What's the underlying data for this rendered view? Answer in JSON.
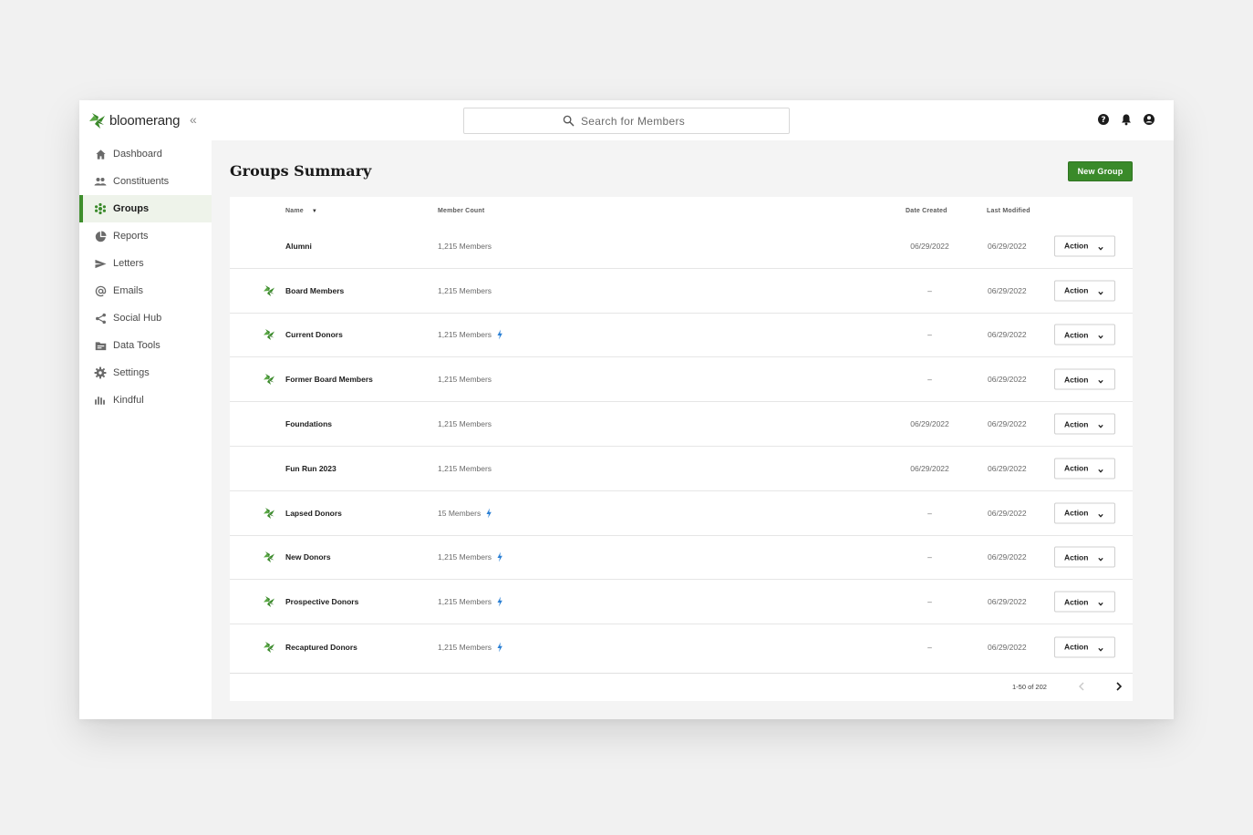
{
  "app": {
    "logo_text": "bloomerang",
    "brand_color": "#3a8a2a",
    "bolt_color": "#2a7fd4"
  },
  "search": {
    "placeholder": "Search for Members"
  },
  "top_icons": [
    "help-icon",
    "bell-icon",
    "account-icon"
  ],
  "sidebar": {
    "items": [
      {
        "label": "Dashboard",
        "icon": "home-icon",
        "active": false
      },
      {
        "label": "Constituents",
        "icon": "people-icon",
        "active": false
      },
      {
        "label": "Groups",
        "icon": "groups-icon",
        "active": true
      },
      {
        "label": "Reports",
        "icon": "pie-chart-icon",
        "active": false
      },
      {
        "label": "Letters",
        "icon": "send-icon",
        "active": false
      },
      {
        "label": "Emails",
        "icon": "at-icon",
        "active": false
      },
      {
        "label": "Social Hub",
        "icon": "share-icon",
        "active": false
      },
      {
        "label": "Data Tools",
        "icon": "folder-icon",
        "active": false
      },
      {
        "label": "Settings",
        "icon": "gear-icon",
        "active": false
      },
      {
        "label": "Kindful",
        "icon": "kindful-icon",
        "active": false
      }
    ]
  },
  "page": {
    "title": "Groups Summary",
    "new_group_label": "New Group"
  },
  "table": {
    "headers": {
      "name": "Name",
      "member_count": "Member Count",
      "date_created": "Date Created",
      "last_modified": "Last Modified"
    },
    "action_label": "Action",
    "rows": [
      {
        "name": "Alumni",
        "count": "1,215 Members",
        "dynamic": false,
        "smart": false,
        "created": "06/29/2022",
        "modified": "06/29/2022"
      },
      {
        "name": "Board Members",
        "count": "1,215 Members",
        "dynamic": true,
        "smart": false,
        "created": "–",
        "modified": "06/29/2022"
      },
      {
        "name": "Current Donors",
        "count": "1,215 Members",
        "dynamic": true,
        "smart": true,
        "created": "–",
        "modified": "06/29/2022"
      },
      {
        "name": "Former Board Members",
        "count": "1,215 Members",
        "dynamic": true,
        "smart": false,
        "created": "–",
        "modified": "06/29/2022"
      },
      {
        "name": "Foundations",
        "count": "1,215 Members",
        "dynamic": false,
        "smart": false,
        "created": "06/29/2022",
        "modified": "06/29/2022"
      },
      {
        "name": "Fun Run 2023",
        "count": "1,215 Members",
        "dynamic": false,
        "smart": false,
        "created": "06/29/2022",
        "modified": "06/29/2022"
      },
      {
        "name": "Lapsed Donors",
        "count": "15 Members",
        "dynamic": true,
        "smart": true,
        "created": "–",
        "modified": "06/29/2022"
      },
      {
        "name": "New Donors",
        "count": "1,215 Members",
        "dynamic": true,
        "smart": true,
        "created": "–",
        "modified": "06/29/2022"
      },
      {
        "name": "Prospective Donors",
        "count": "1,215 Members",
        "dynamic": true,
        "smart": true,
        "created": "–",
        "modified": "06/29/2022"
      },
      {
        "name": "Recaptured Donors",
        "count": "1,215 Members",
        "dynamic": true,
        "smart": true,
        "created": "–",
        "modified": "06/29/2022"
      }
    ]
  },
  "pagination": {
    "range_text": "1-50 of 202"
  }
}
